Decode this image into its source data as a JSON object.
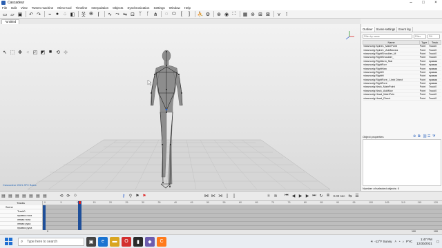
{
  "window": {
    "title": "Cascadeur"
  },
  "menu": [
    "File",
    "Edit",
    "View",
    "Tween machine",
    "Mirror tool",
    "Timeline",
    "Interpolation",
    "Objects",
    "Synchronization",
    "Settings",
    "Window",
    "Help"
  ],
  "document_tab": "*untitled",
  "viewport": {
    "caption": "Cascadeur 2021.3FX Basic"
  },
  "outliner": {
    "tabs": [
      "Outliner",
      "Scene settings",
      "Event log"
    ],
    "filter_placeholder": "Filter by name",
    "filter2_placeholder": "Filter",
    "filter3_placeholder": "Filt",
    "columns": [
      "Name",
      "Type",
      "Track"
    ],
    "rows": [
      {
        "name": "mixamorig:Spine1_MainPoint",
        "type": "Point",
        "track": "Track0"
      },
      {
        "name": "mixamorig:Spine1_AddMovea",
        "type": "Point",
        "track": "Track0"
      },
      {
        "name": "mixamorig:RightShoulder_M",
        "type": "Point",
        "track": "Track0"
      },
      {
        "name": "mixamorig:RightShoulder_",
        "type": "Point",
        "track": "Track0"
      },
      {
        "name": "mixamorig:RightArm_Mai",
        "type": "Point",
        "track": "правая"
      },
      {
        "name": "mixamorig:RightForr",
        "type": "Point",
        "track": "правая"
      },
      {
        "name": "mixamorig:RightHan",
        "type": "Point",
        "track": "правая"
      },
      {
        "name": "mixamorig:RightH",
        "type": "Point",
        "track": "правая"
      },
      {
        "name": "mixamorig:RightH",
        "type": "Point",
        "track": "правая"
      },
      {
        "name": "mixamorig:RightFore_ Limb Direct",
        "type": "Point",
        "track": "правая"
      },
      {
        "name": "mixamorig:RightFore",
        "type": "Point",
        "track": "правая"
      },
      {
        "name": "mixamorig:Neck_MainPoint",
        "type": "Point",
        "track": "Track0"
      },
      {
        "name": "mixamorig:Neck_AddMov",
        "type": "Point",
        "track": "Track0"
      },
      {
        "name": "mixamorig:Head_MainPoin",
        "type": "Point",
        "track": "Track0"
      },
      {
        "name": "mixamorig:Head_Direct",
        "type": "Point",
        "track": "Track0"
      }
    ],
    "properties_title": "Object properties",
    "selected_status": "Number of selected objects: 0"
  },
  "playback": {
    "time": "0.00 sec"
  },
  "timeline": {
    "header": "Tracks",
    "tracks": [
      "Scene",
      "Track0",
      "правая нога",
      "левая нога",
      "левая рука",
      "правая рука"
    ],
    "ticks": [
      "0",
      "5",
      "10",
      "15",
      "20",
      "25",
      "30",
      "35",
      "40",
      "45",
      "50",
      "55",
      "60",
      "65",
      "70",
      "75",
      "80",
      "85",
      "90",
      "95",
      "100",
      "105",
      "110",
      "115",
      "120"
    ],
    "start_frame": "0",
    "end_frame": "100",
    "end_value": "100"
  },
  "taskbar": {
    "search_placeholder": "Type here to search",
    "weather": "-12°F Sunny",
    "language": "PYC",
    "time": "1:47 PM",
    "date": "12/30/2021"
  }
}
